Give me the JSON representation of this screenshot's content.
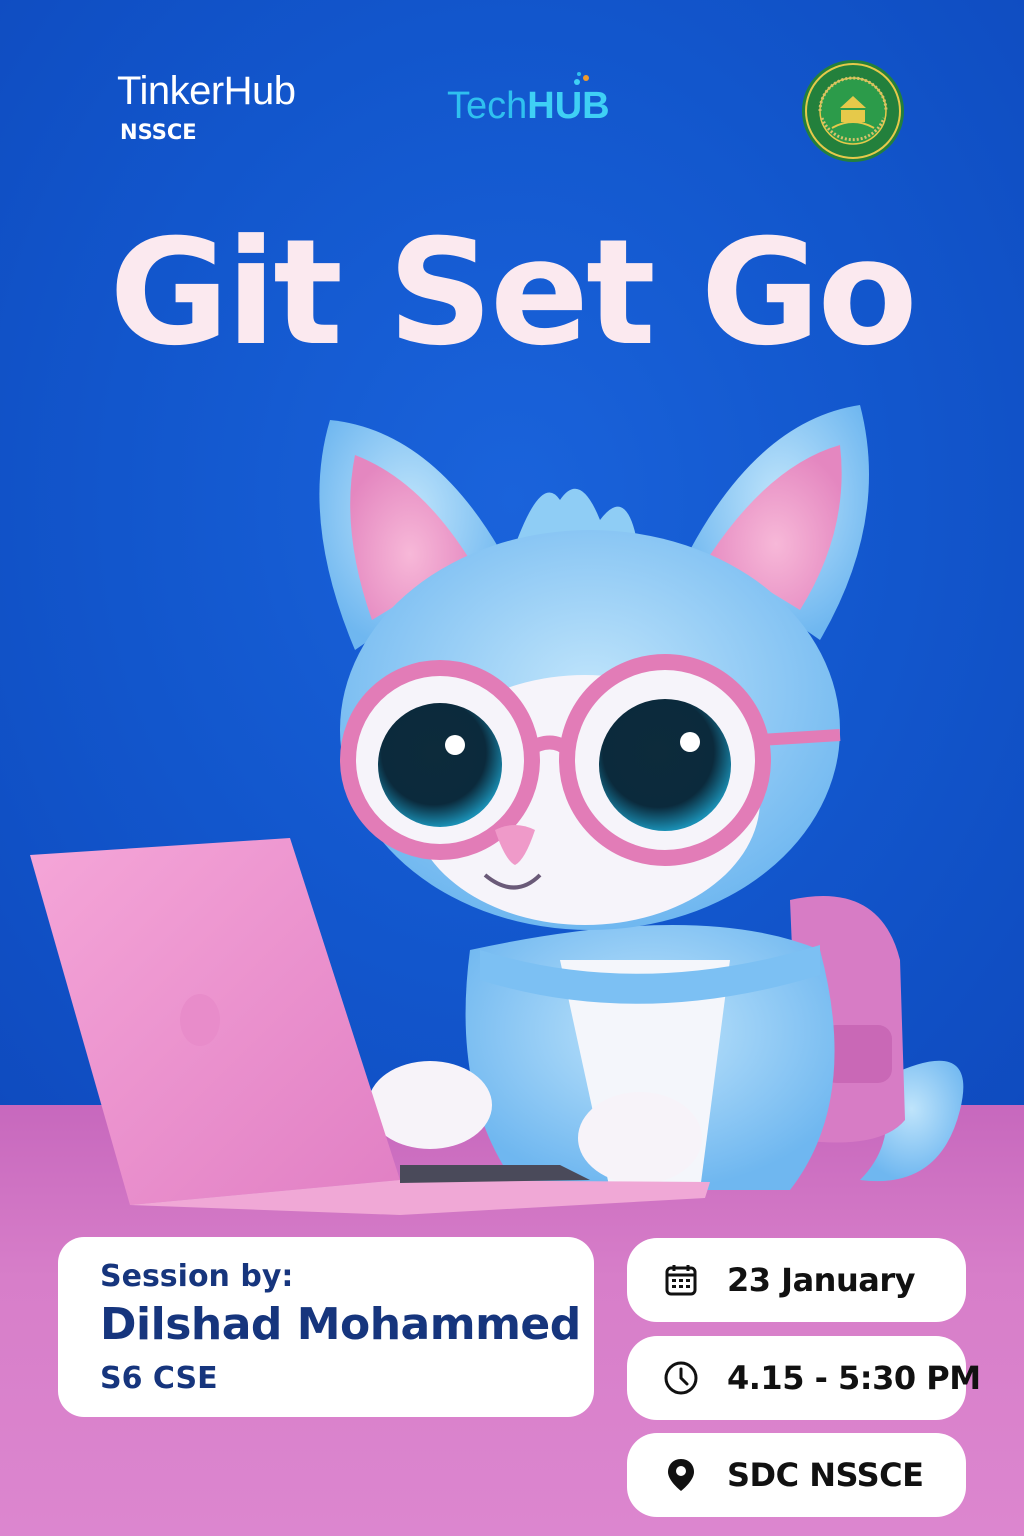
{
  "logos": {
    "tinkerhub_name": "TinkerHub",
    "tinkerhub_chapter": "NSSCE",
    "techhub_part1": "Tech",
    "techhub_part2": "HUB"
  },
  "title": "Git Set Go",
  "session": {
    "label": "Session by:",
    "speaker": "Dilshad Mohammed",
    "dept": "S6 CSE"
  },
  "details": {
    "date": "23 January",
    "time": "4.15 - 5:30 PM",
    "venue": "SDC NSSCE"
  },
  "icons": {
    "date": "calendar-icon",
    "time": "clock-icon",
    "venue": "location-pin-icon"
  },
  "colors": {
    "background_top": "#1256cc",
    "background_bottom": "#d77ec9",
    "title": "#fbe9ef",
    "card_text": "#16357d"
  }
}
